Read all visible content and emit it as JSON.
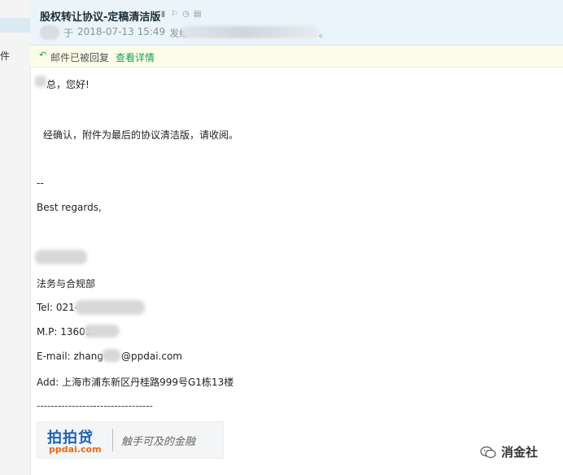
{
  "sidebar": {
    "partial_label": "件"
  },
  "header": {
    "subject": "股权转让协议-定稿清洁版",
    "icons": [
      "flag-icon",
      "follow-flag-icon",
      "clock-icon",
      "print-icon"
    ],
    "date_prefix": "于",
    "datetime": "2018-07-13 15:49",
    "sent_label": "发给",
    "recipient_tail": "。"
  },
  "notice": {
    "reply_icon": "reply-icon",
    "text": "邮件已被回复",
    "link": "查看详情"
  },
  "body": {
    "greeting": "总，您好!",
    "line1": "经确认，附件为最后的协议清洁版，请收阅。",
    "sig_sep": "--",
    "regards": "Best regards,",
    "dept": "法务与合规部",
    "tel": "Tel: 021-",
    "mp": "M.P: 13601",
    "email_pre": "E-mail:  zhang",
    "email_post": "@ppdai.com",
    "address": "Add: 上海市浦东新区丹桂路999号G1栋13楼",
    "dashes": "---------------------------------"
  },
  "logo": {
    "brand_cn": "拍拍贷",
    "brand_en": "ppdai.com",
    "slogan": "触手可及的金融"
  },
  "watermark": {
    "text": "消金社"
  },
  "colors": {
    "header_bg": "#eaf4fa",
    "notice_bg": "#fbfce9",
    "link": "#1e9e58",
    "brand_blue": "#1e63b4",
    "brand_orange": "#e86a1a"
  }
}
